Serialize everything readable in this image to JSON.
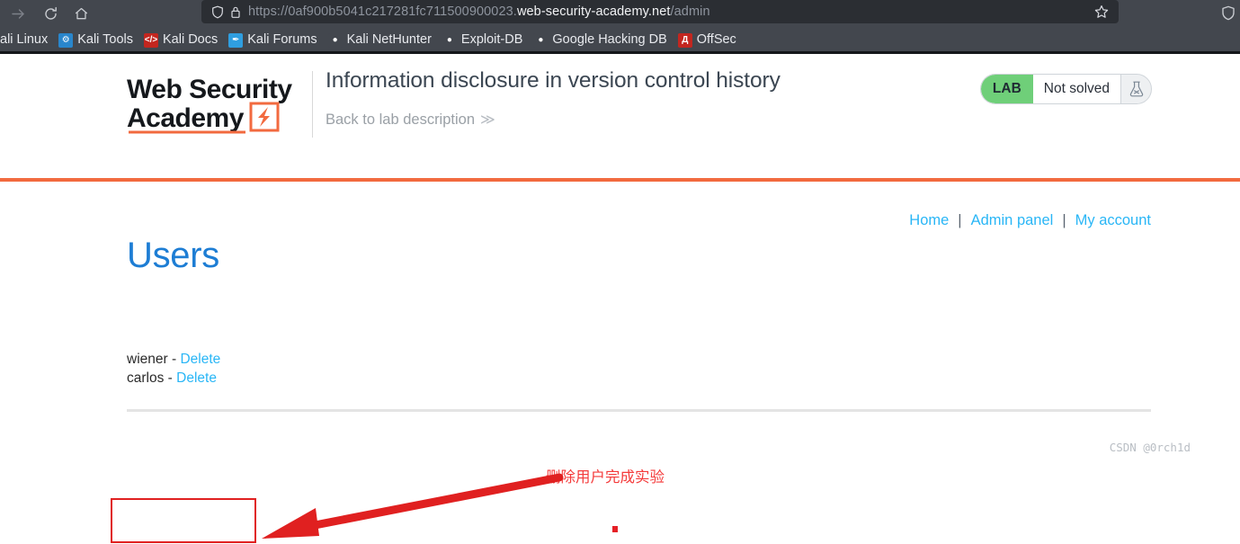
{
  "browser": {
    "nav_buttons": [
      {
        "name": "forward",
        "icon": "arrow-right-icon",
        "enabled": false
      },
      {
        "name": "reload",
        "icon": "reload-icon",
        "enabled": true
      },
      {
        "name": "home",
        "icon": "home-icon",
        "enabled": true
      }
    ],
    "urlbar": {
      "shield_icon": "shield-icon",
      "lock_icon": "lock-icon",
      "url_prefix": "https://0af900b5041c217281fc711500900023.",
      "url_domain": "web-security-academy.net",
      "url_path": "/admin",
      "star_icon": "star-icon"
    },
    "right_icon": "shield-icon",
    "bookmarks": [
      {
        "label": "ali Linux",
        "icon_text": "",
        "icon_color": "#43474e"
      },
      {
        "label": "Kali Tools",
        "icon_text": "⚙",
        "icon_color": "#2986cc"
      },
      {
        "label": "Kali Docs",
        "icon_text": "</>",
        "icon_color": "#c3261f"
      },
      {
        "label": "Kali Forums",
        "icon_text": "✒",
        "icon_color": "#2f9ee0"
      },
      {
        "label": "Kali NetHunter",
        "icon_text": "●",
        "icon_color": "#43474e"
      },
      {
        "label": "Exploit-DB",
        "icon_text": "●",
        "icon_color": "#43474e"
      },
      {
        "label": "Google Hacking DB",
        "icon_text": "●",
        "icon_color": "#43474e"
      },
      {
        "label": "OffSec",
        "icon_text": "Д",
        "icon_color": "#c3261f"
      }
    ]
  },
  "header": {
    "logo_line1": "Web Security",
    "logo_line2": "Academy",
    "lab_title": "Information disclosure in version control history",
    "back_link": "Back to lab description",
    "back_chevrons": "≫",
    "status_tag": "LAB",
    "status_text": "Not solved",
    "status_icon": "flask-icon",
    "accent_color": "#f26a3f",
    "status_tag_color": "#6fcf79"
  },
  "top_nav": {
    "links": [
      "Home",
      "Admin panel",
      "My account"
    ],
    "separator": "|",
    "link_color": "#29b6f6"
  },
  "main": {
    "heading": "Users",
    "delete_label": "Delete",
    "separator": "-",
    "users": [
      {
        "name": "wiener"
      },
      {
        "name": "carlos"
      }
    ]
  },
  "annotations": {
    "note_text": "删除用户完成实验",
    "note_color": "#f43b3b",
    "box_color": "#e02020",
    "arrow_color": "#e02020"
  },
  "watermark": "CSDN @0rch1d"
}
